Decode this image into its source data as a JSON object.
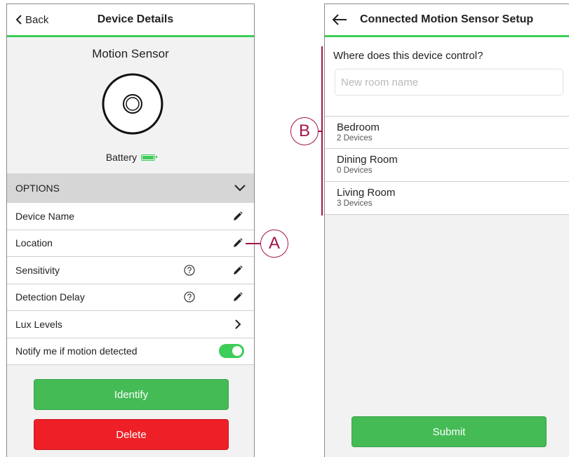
{
  "left_screen": {
    "header": {
      "back_label": "Back",
      "title": "Device Details"
    },
    "device": {
      "name": "Motion Sensor",
      "battery_label": "Battery",
      "battery_icon": "battery-full-icon"
    },
    "options_header": "OPTIONS",
    "rows": [
      {
        "label": "Device Name",
        "action_icon": "pencil-icon"
      },
      {
        "label": "Location",
        "action_icon": "pencil-icon"
      },
      {
        "label": "Sensitivity",
        "help_icon": "question-icon",
        "action_icon": "pencil-icon"
      },
      {
        "label": "Detection Delay",
        "help_icon": "question-icon",
        "action_icon": "pencil-icon"
      },
      {
        "label": "Lux Levels",
        "action_icon": "chevron-right-icon"
      },
      {
        "label": "Notify me if motion detected",
        "toggle_on": true
      }
    ],
    "identify_label": "Identify",
    "delete_label": "Delete"
  },
  "right_screen": {
    "header": {
      "title": "Connected Motion Sensor Setup"
    },
    "question": "Where does this device control?",
    "room_input": {
      "placeholder": "New room name",
      "value": ""
    },
    "rooms": [
      {
        "name": "Bedroom",
        "count": "2 Devices"
      },
      {
        "name": "Dining Room",
        "count": "0 Devices"
      },
      {
        "name": "Living Room",
        "count": "3 Devices"
      }
    ],
    "submit_label": "Submit"
  },
  "callouts": {
    "a": "A",
    "b": "B"
  },
  "colors": {
    "accent": "#3dcd58",
    "identify": "#44bb55",
    "delete": "#ee1f26",
    "callout": "#a3144d",
    "options_bg": "#d6d6d6"
  }
}
